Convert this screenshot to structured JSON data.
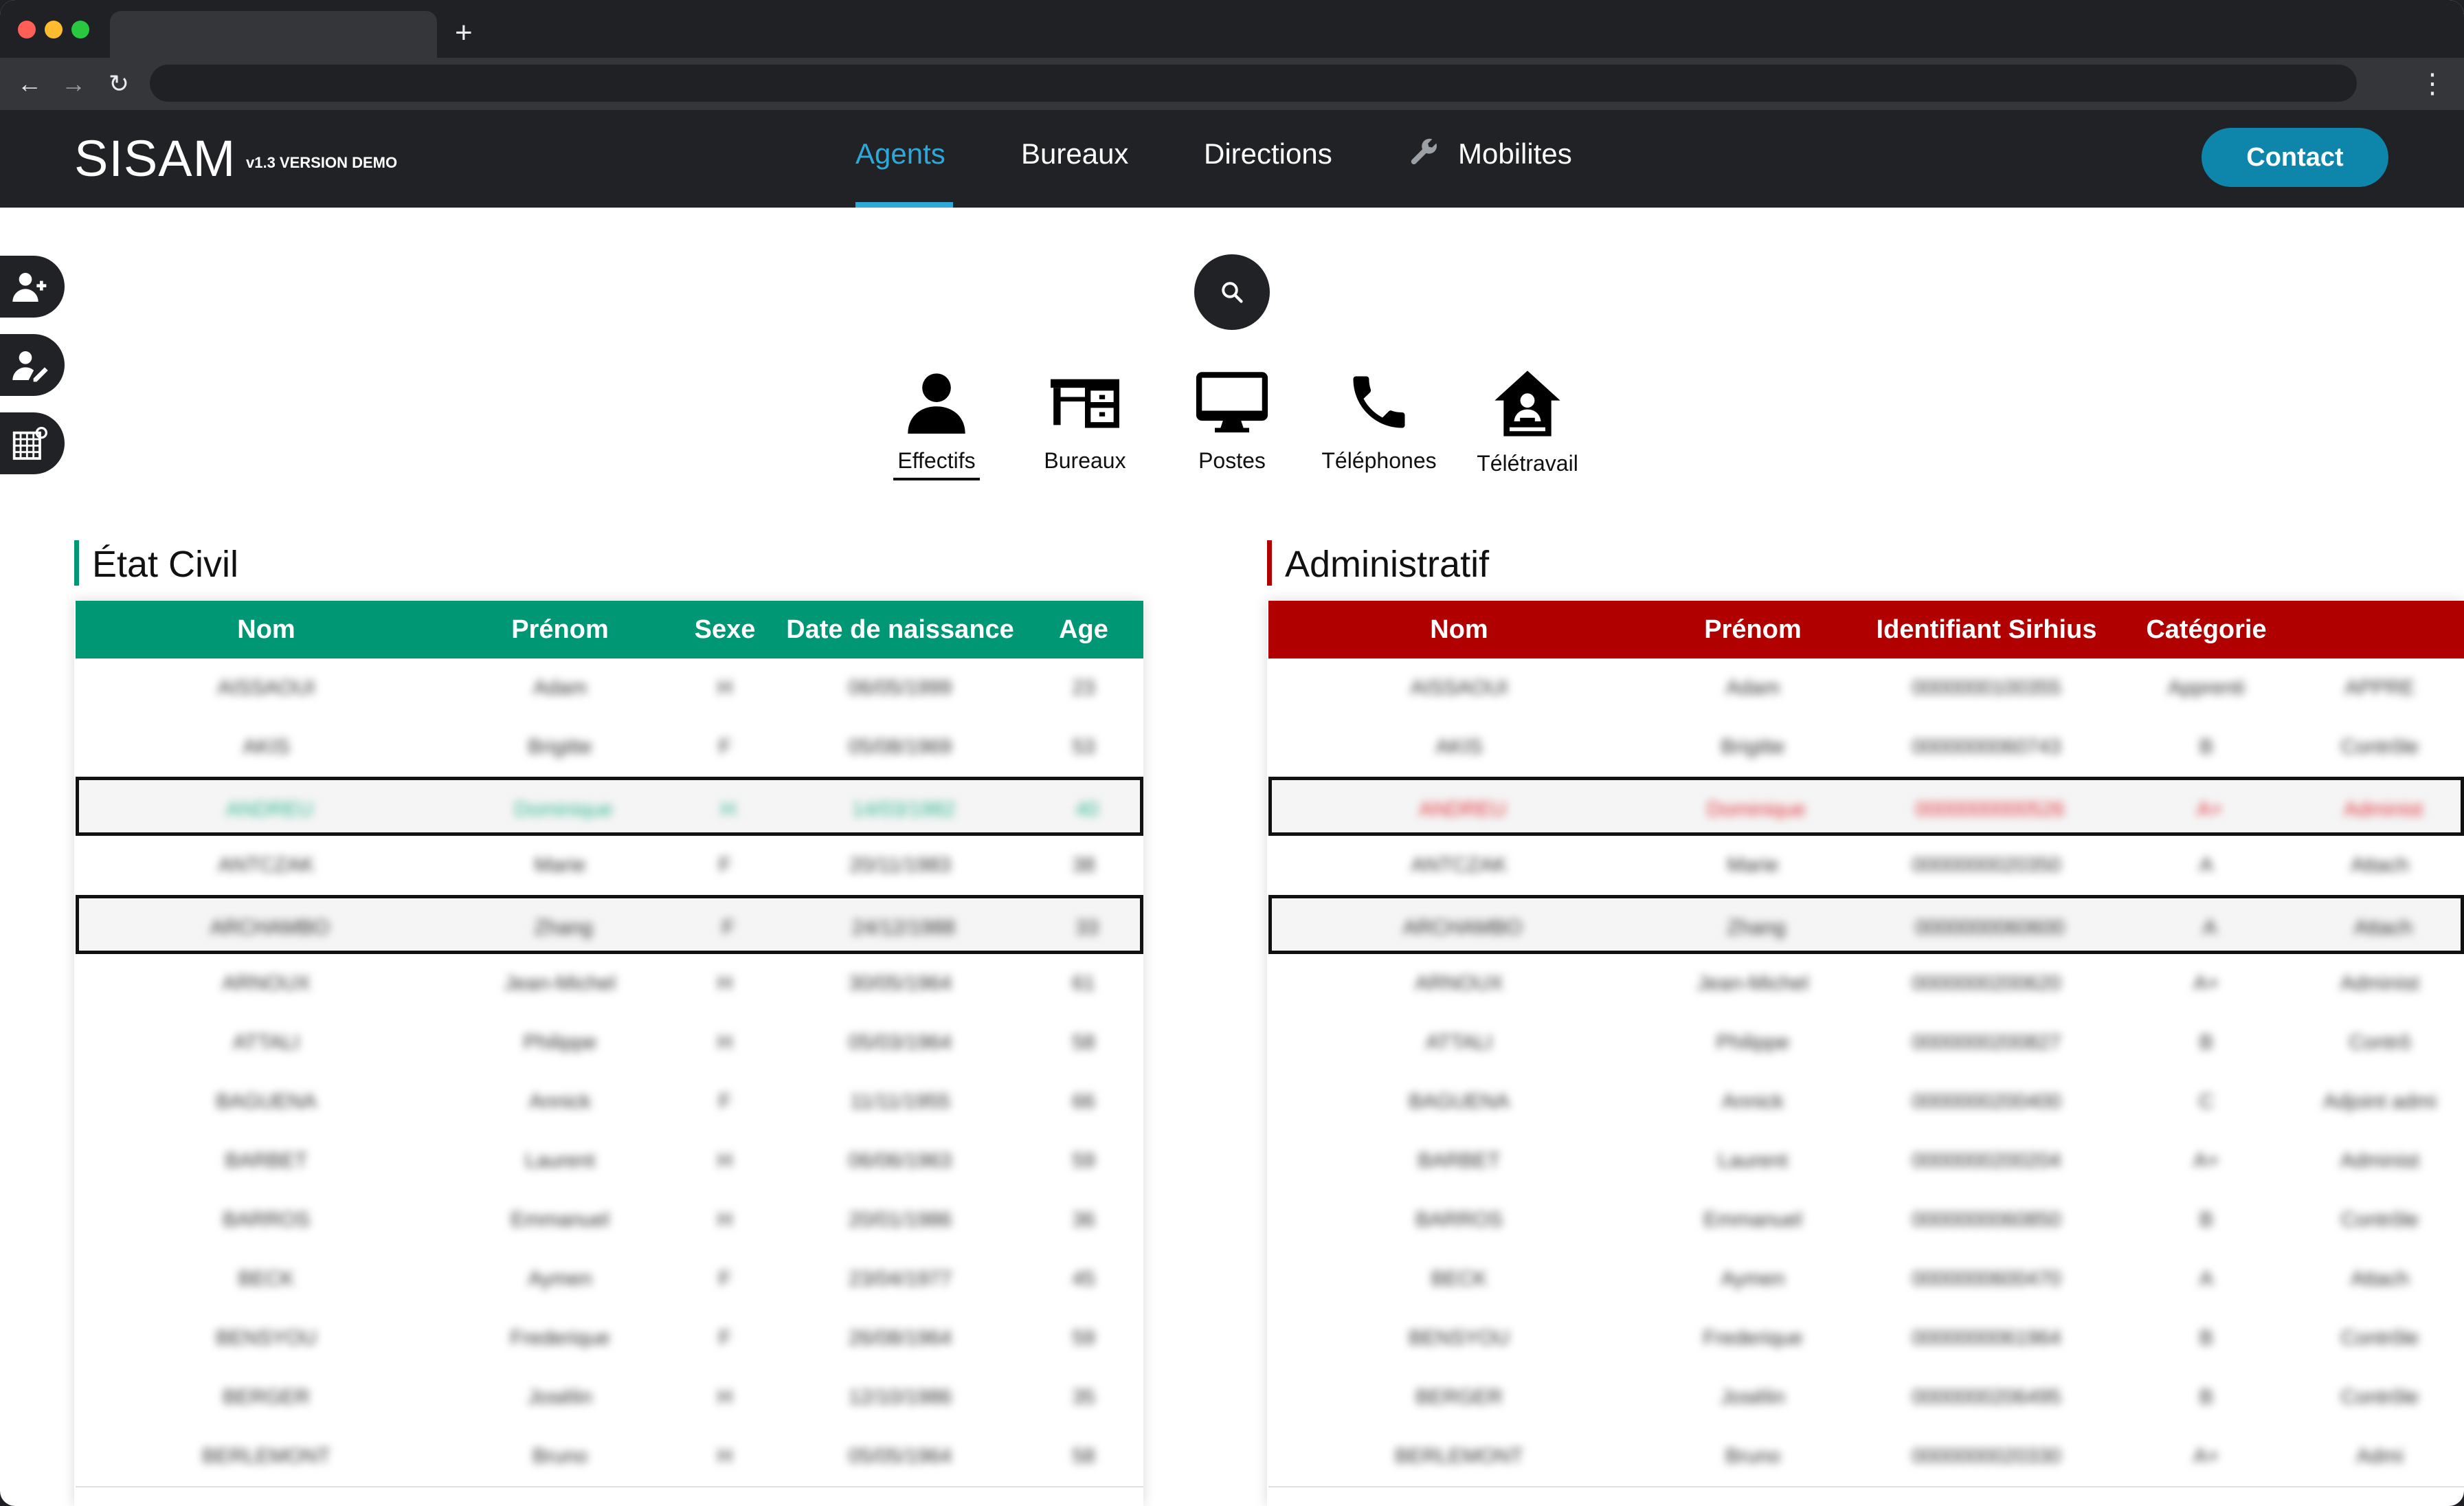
{
  "app": {
    "brand": "SISAM",
    "version": "v1.3 VERSION DEMO",
    "contact_label": "Contact",
    "menu": [
      "Agents",
      "Bureaux",
      "Directions",
      "Mobilites"
    ],
    "active_color": "#2ea8d8"
  },
  "categories": [
    {
      "label": "Effectifs",
      "icon": "person-icon"
    },
    {
      "label": "Bureaux",
      "icon": "desk-icon"
    },
    {
      "label": "Postes",
      "icon": "monitor-icon"
    },
    {
      "label": "Téléphones",
      "icon": "phone-icon"
    },
    {
      "label": "Télétravail",
      "icon": "home-office-icon"
    }
  ],
  "etat_civil": {
    "title": "État Civil",
    "accent": "#009775",
    "columns": [
      "Nom",
      "Prénom",
      "Sexe",
      "Date de naissance",
      "Age"
    ],
    "rows": [
      [
        "AISSAOUI",
        "Adam",
        "H",
        "06/05/1999",
        "23"
      ],
      [
        "AKIS",
        "Brigitte",
        "F",
        "05/08/1969",
        "53"
      ],
      [
        "ANDREU",
        "Dominique",
        "H",
        "14/03/1982",
        "40"
      ],
      [
        "ANTCZAK",
        "Marie",
        "F",
        "20/11/1983",
        "38"
      ],
      [
        "ARCHAMBO",
        "Zhang",
        "F",
        "24/12/1988",
        "33"
      ],
      [
        "ARNOUX",
        "Jean-Michel",
        "H",
        "30/05/1964",
        "61"
      ],
      [
        "ATTALI",
        "Philippe",
        "H",
        "05/03/1964",
        "58"
      ],
      [
        "BAGUENA",
        "Annick",
        "F",
        "11/11/1955",
        "66"
      ],
      [
        "BARBET",
        "Laurent",
        "H",
        "06/06/1963",
        "59"
      ],
      [
        "BARROS",
        "Emmanuel",
        "H",
        "20/01/1986",
        "36"
      ],
      [
        "BECK",
        "Aymen",
        "F",
        "23/04/1977",
        "45"
      ],
      [
        "BENSYOU",
        "Frederique",
        "F",
        "26/08/1964",
        "59"
      ],
      [
        "BERGER",
        "Josélin",
        "H",
        "12/10/1986",
        "35"
      ],
      [
        "BERLEMONT",
        "Bruno",
        "H",
        "05/05/1964",
        "58"
      ]
    ]
  },
  "administratif": {
    "title": "Administratif",
    "accent": "#b00000",
    "columns": [
      "Nom",
      "Prénom",
      "Identifiant Sirhius",
      "Catégorie"
    ],
    "rows": [
      [
        "AISSAOUI",
        "Adam",
        "0000000100355",
        "Apprenti",
        "APPRE"
      ],
      [
        "AKIS",
        "Brigitte",
        "0000000060743",
        "B",
        "Contrôle"
      ],
      [
        "ANDREU",
        "Dominique",
        "0000000000526",
        "A+",
        "Administ"
      ],
      [
        "ANTCZAK",
        "Marie",
        "0000000020350",
        "A",
        "Attach"
      ],
      [
        "ARCHAMBO",
        "Zhang",
        "0000000060600",
        "A",
        "Attach"
      ],
      [
        "ARNOUX",
        "Jean-Michel",
        "0000000200620",
        "A+",
        "Administ"
      ],
      [
        "ATTALI",
        "Philippe",
        "0000000200827",
        "B",
        "Contrô"
      ],
      [
        "BAGUENA",
        "Annick",
        "0000000200400",
        "C",
        "Adjoint admi"
      ],
      [
        "BARBET",
        "Laurent",
        "0000000200204",
        "A+",
        "Administ"
      ],
      [
        "BARROS",
        "Emmanuel",
        "0000000060850",
        "B",
        "Contrôle"
      ],
      [
        "BECK",
        "Aymen",
        "0000000600470",
        "A",
        "Attach"
      ],
      [
        "BENSYOU",
        "Frederique",
        "0000000061964",
        "B",
        "Contrôle"
      ],
      [
        "BERGER",
        "Josélin",
        "0000000206495",
        "B",
        "Contrôle"
      ],
      [
        "BERLEMONT",
        "Bruno",
        "0000000020330",
        "A+",
        "Admi"
      ]
    ]
  }
}
